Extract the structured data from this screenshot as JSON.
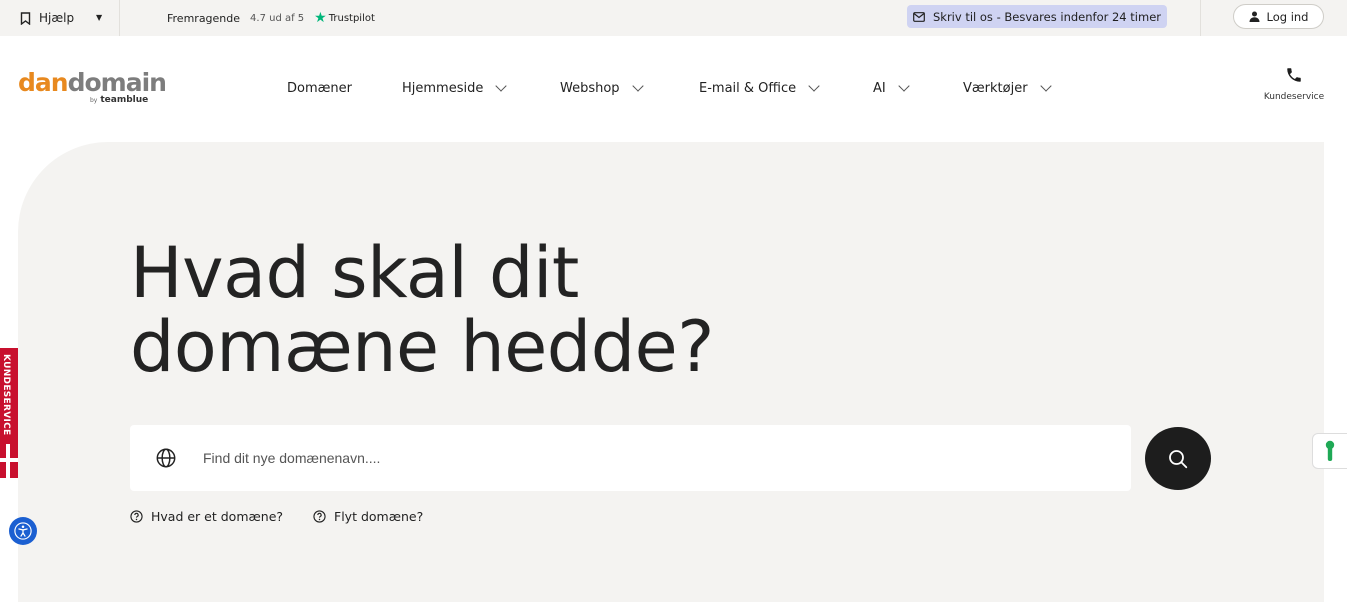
{
  "topbar": {
    "help_label": "Hjælp",
    "rating_label": "Fremragende",
    "rating_score": "4.7 ud af 5",
    "trustpilot_label": "Trustpilot",
    "write_us": "Skriv til os - Besvares indenfor 24 timer",
    "login_label": "Log ind"
  },
  "logo": {
    "part1": "dan",
    "part2": "domain",
    "by": "by",
    "brand": "teamblue"
  },
  "nav": {
    "items": [
      {
        "label": "Domæner"
      },
      {
        "label": "Hjemmeside"
      },
      {
        "label": "Webshop"
      },
      {
        "label": "E-mail & Office"
      },
      {
        "label": "AI"
      },
      {
        "label": "Værktøjer"
      }
    ],
    "support_label": "Kundeservice"
  },
  "hero": {
    "headline_line1": "Hvad skal dit",
    "headline_line2": "domæne hedde?",
    "search_placeholder": "Find dit nye domænenavn....",
    "link1": "Hvad er et domæne?",
    "link2": "Flyt domæne?"
  },
  "side": {
    "tab_label": "KUNDESERVICE"
  },
  "colors": {
    "accent_orange": "#e8891f",
    "hero_bg": "#f4f3f1",
    "write_bg": "#cfd3f2",
    "side_tab_red": "#c8102e",
    "a11y_blue": "#1b5fd1"
  }
}
